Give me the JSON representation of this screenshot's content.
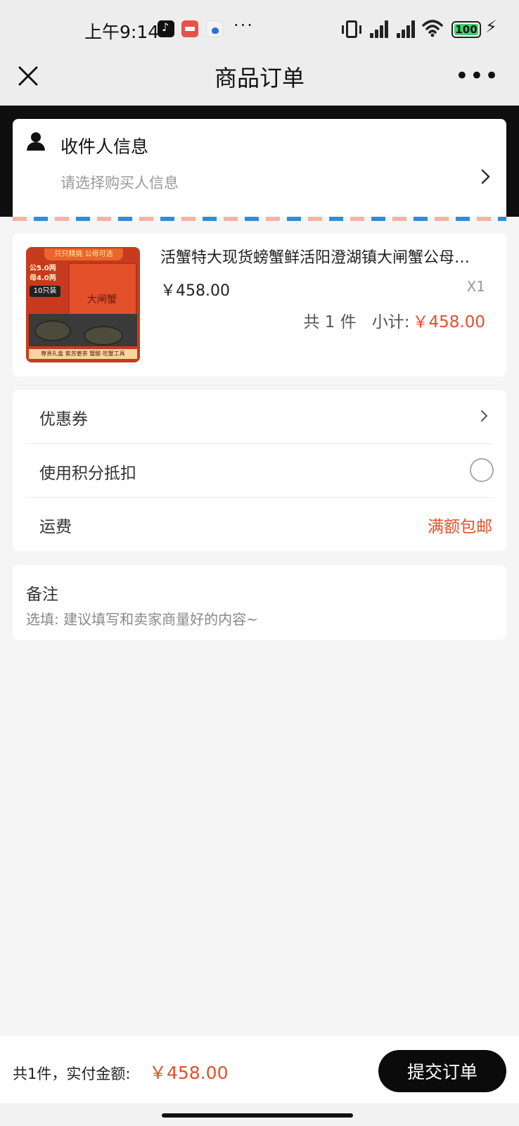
{
  "status_bar": {
    "time": "上午9:14",
    "battery": "100",
    "battery_level": 1.0,
    "icons": [
      "tiktok-icon",
      "red-app-icon",
      "baidu-icon",
      "more-dots-icon",
      "vibrate-icon",
      "signal-icon",
      "signal-icon",
      "wifi-icon",
      "battery-icon",
      "charging-icon"
    ]
  },
  "nav": {
    "title": "商品订单",
    "close_icon": "close-icon",
    "more_label": "•••"
  },
  "recipient": {
    "title": "收件人信息",
    "hint": "请选择购买人信息"
  },
  "product": {
    "name": "活蟹特大现货螃蟹鲜活阳澄湖镇大闸蟹公母可选",
    "price": "￥458.00",
    "quantity": "X1",
    "count_text": "共 1 件",
    "subtotal_label": "小计:",
    "subtotal_value": "￥458.00",
    "image": {
      "banner": "只只精挑 公母可选",
      "weight_male": "公5.0两",
      "weight_female": "母4.0两",
      "pack_tag": "10只装",
      "box_title": "大闸蟹",
      "bottom_text": "尊贵礼盒 紫苏姜茶 蟹醋 吃蟹工具"
    }
  },
  "options": {
    "coupon_label": "优惠券",
    "points_label": "使用积分抵扣",
    "points_enabled": false,
    "shipping_label": "运费",
    "shipping_value": "满额包邮"
  },
  "remarks": {
    "title": "备注",
    "placeholder": "选填: 建议填写和卖家商量好的内容~",
    "value": ""
  },
  "footer": {
    "total_label": "共1件，实付金额:",
    "total_value": "￥458.00",
    "submit_label": "提交订单"
  },
  "colors": {
    "accent": "#e0502c",
    "background": "#f5f5f5",
    "nav_background": "#ededed",
    "header_band": "#0f0f0f",
    "submit_button": "#0b0b0b"
  }
}
